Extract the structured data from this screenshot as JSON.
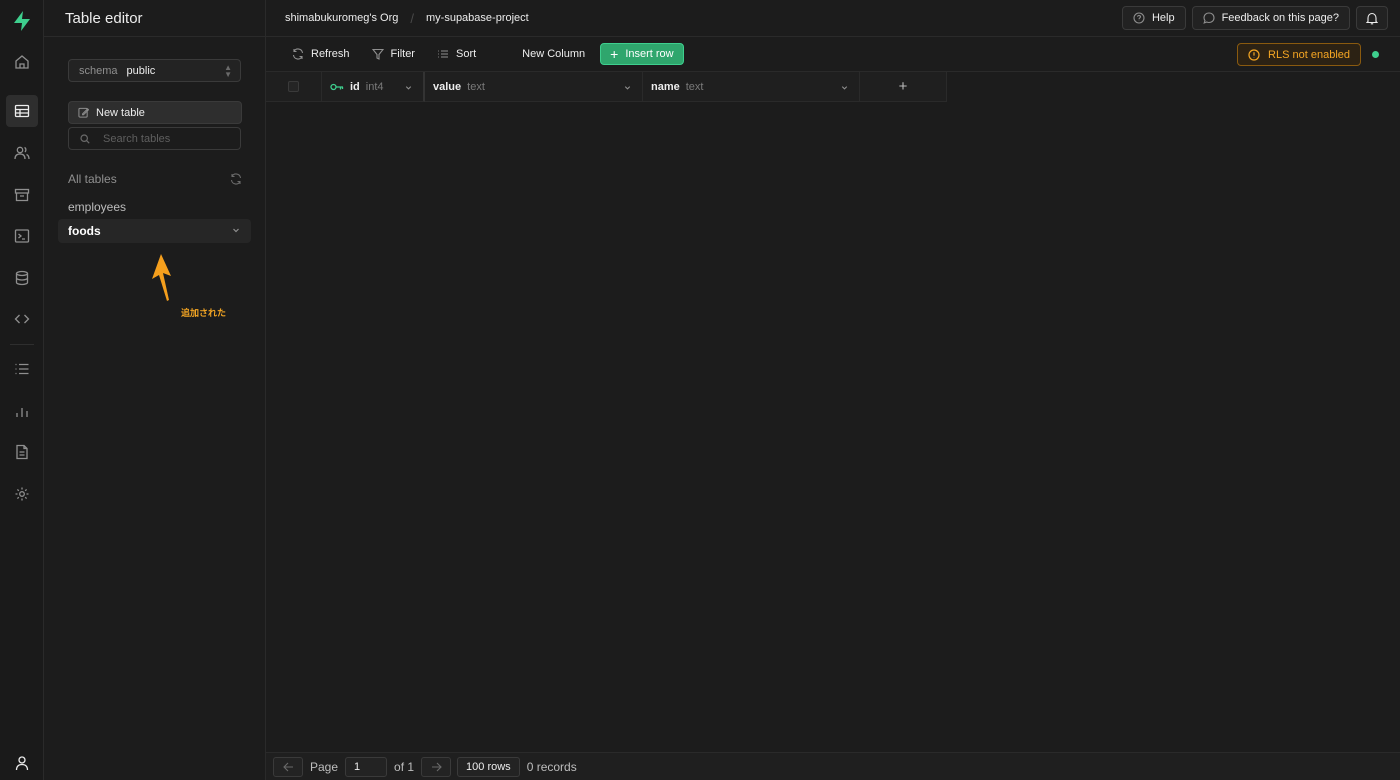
{
  "sidebar": {
    "title": "Table editor",
    "schema": {
      "label": "schema",
      "value": "public"
    },
    "new_table_label": "New table",
    "search_placeholder": "Search tables",
    "all_tables_label": "All tables",
    "tables": [
      {
        "name": "employees",
        "selected": false
      },
      {
        "name": "foods",
        "selected": true
      }
    ],
    "annotation": "追加された"
  },
  "breadcrumb": {
    "org": "shimabukuromeg's Org",
    "separator": "/",
    "project": "my-supabase-project"
  },
  "topbar": {
    "help_label": "Help",
    "feedback_label": "Feedback on this page?"
  },
  "toolbar": {
    "refresh_label": "Refresh",
    "filter_label": "Filter",
    "sort_label": "Sort",
    "new_column_label": "New Column",
    "insert_row_label": "Insert row",
    "rls_label": "RLS not enabled"
  },
  "grid": {
    "columns": [
      {
        "name": "id",
        "type": "int4",
        "primary_key": true
      },
      {
        "name": "value",
        "type": "text",
        "primary_key": false
      },
      {
        "name": "name",
        "type": "text",
        "primary_key": false
      }
    ],
    "add_column_symbol": "+"
  },
  "footer": {
    "page_label": "Page",
    "page_value": "1",
    "of_label": "of 1",
    "rows_label": "100 rows",
    "records_label": "0 records"
  },
  "colors": {
    "brand": "#3ecf8e",
    "warning": "#f5a623",
    "background": "#1c1c1c"
  }
}
